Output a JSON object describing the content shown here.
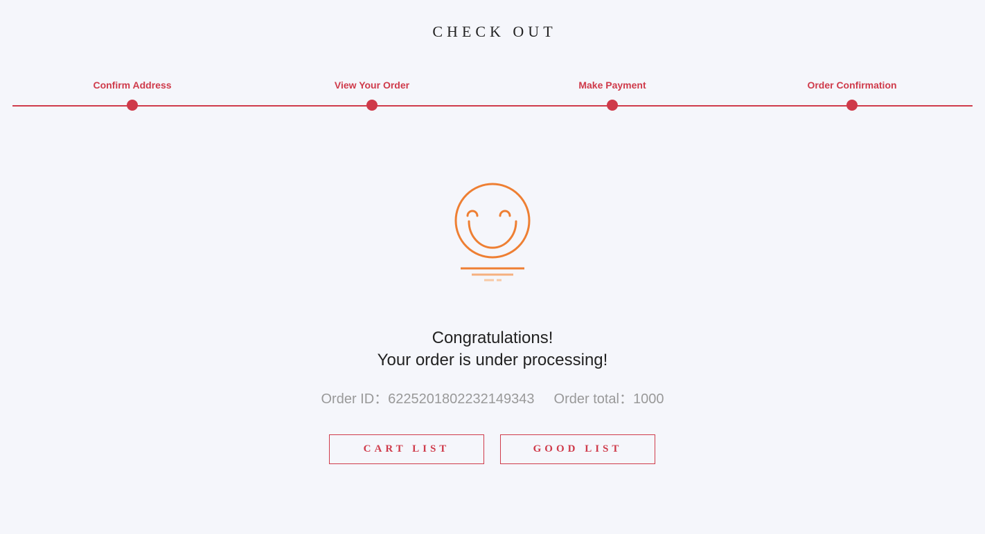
{
  "header": {
    "title": "CHECK OUT"
  },
  "steps": [
    {
      "label": "Confirm Address"
    },
    {
      "label": "View Your Order"
    },
    {
      "label": "Make Payment"
    },
    {
      "label": "Order Confirmation"
    }
  ],
  "result": {
    "icon": "smiley-icon",
    "line1": "Congratulations!",
    "line2": "Your order is under processing!",
    "order_id_label": "Order ID：",
    "order_id": "6225201802232149343",
    "order_total_label": "Order total：",
    "order_total": "1000"
  },
  "actions": {
    "cart_list_label": "CART LIST",
    "good_list_label": "GOOD LIST"
  },
  "colors": {
    "accent": "#cf3a4a",
    "icon": "#ee7f33",
    "background": "#f5f6fb"
  }
}
